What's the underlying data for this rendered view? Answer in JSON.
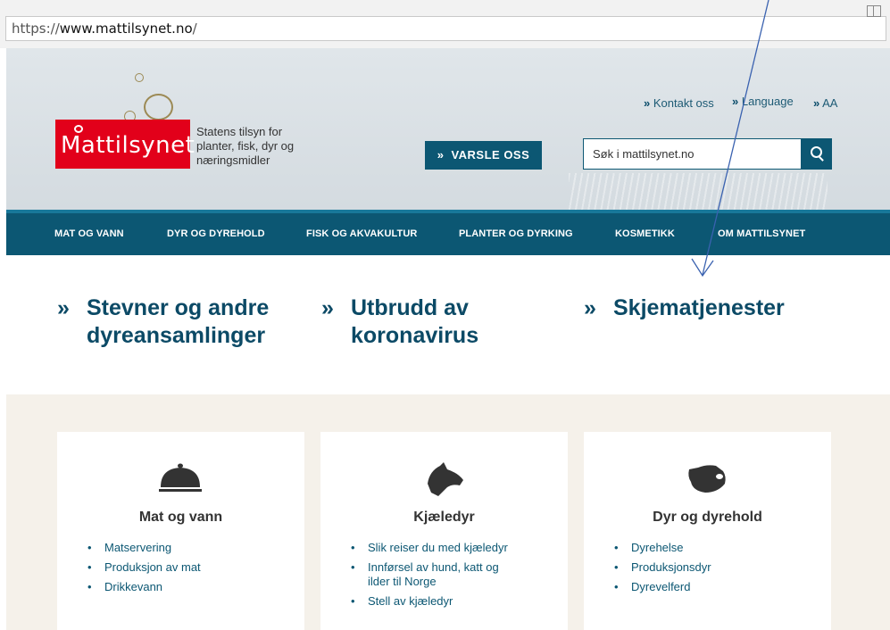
{
  "browser": {
    "url_prefix": "https://",
    "url_domain": "www.mattilsynet.no",
    "url_suffix": "/"
  },
  "header": {
    "logo_text": "Mattilsynet",
    "tagline": [
      "Statens tilsyn for",
      "planter, fisk, dyr og",
      "næringsmidler"
    ],
    "links": [
      "Kontakt oss",
      "Language",
      "AA"
    ],
    "report_button": "VARSLE OSS",
    "search_placeholder": "Søk i mattilsynet.no",
    "brand_red": "#e2001a",
    "brand_blue": "#0c5773"
  },
  "nav": {
    "items": [
      "MAT OG VANN",
      "DYR OG DYREHOLD",
      "FISK OG AKVAKULTUR",
      "PLANTER OG DYRKING",
      "KOSMETIKK",
      "OM MATTILSYNET"
    ]
  },
  "featured": [
    {
      "lines": [
        "Stevner og andre",
        "dyreansamlinger"
      ]
    },
    {
      "lines": [
        "Utbrudd av",
        "koronavirus"
      ]
    },
    {
      "lines": [
        "Skjematjenester"
      ]
    }
  ],
  "cards": [
    {
      "icon": "food-cloche-icon",
      "title": "Mat og vann",
      "items": [
        [
          "Matservering"
        ],
        [
          "Produksjon av mat"
        ],
        [
          "Drikkevann"
        ]
      ]
    },
    {
      "icon": "dog-head-icon",
      "title": "Kjæledyr",
      "items": [
        [
          "Slik reiser du med kjæledyr"
        ],
        [
          "Innførsel av hund, katt og",
          "ilder til Norge"
        ],
        [
          "Stell av kjæledyr"
        ]
      ]
    },
    {
      "icon": "pig-head-icon",
      "title": "Dyr og dyrehold",
      "items": [
        [
          "Dyrehelse"
        ],
        [
          "Produksjonsdyr"
        ],
        [
          "Dyrevelferd"
        ]
      ]
    }
  ]
}
